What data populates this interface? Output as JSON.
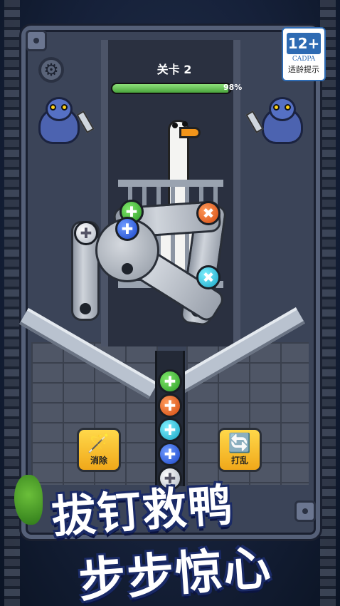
{
  "hud": {
    "level_label": "关卡 2",
    "progress_percent": 98,
    "progress_text": "98%"
  },
  "age_rating": {
    "rating": "12+",
    "org": "CADPA",
    "tip": "适龄提示"
  },
  "tools": {
    "eliminate_label": "消除",
    "shuffle_label": "打乱"
  },
  "puzzle": {
    "board_screws": [
      "green",
      "orange",
      "blue",
      "white",
      "cyan"
    ],
    "tube_screws": [
      "green",
      "orange",
      "cyan",
      "blue",
      "white"
    ]
  },
  "banner": {
    "line1": "拔钉救鸭",
    "line2": "步步惊心"
  },
  "colors": {
    "green": "#3cb832",
    "orange": "#e8601a",
    "cyan": "#1fbcd9",
    "blue": "#2457e0",
    "white": "#e6e9ee",
    "progress": "#6cc557",
    "tool_button": "#f5bd2a"
  },
  "icons": {
    "settings": "gear-icon",
    "eliminate": "magic-wand-icon",
    "shuffle": "shuffle-icon"
  }
}
